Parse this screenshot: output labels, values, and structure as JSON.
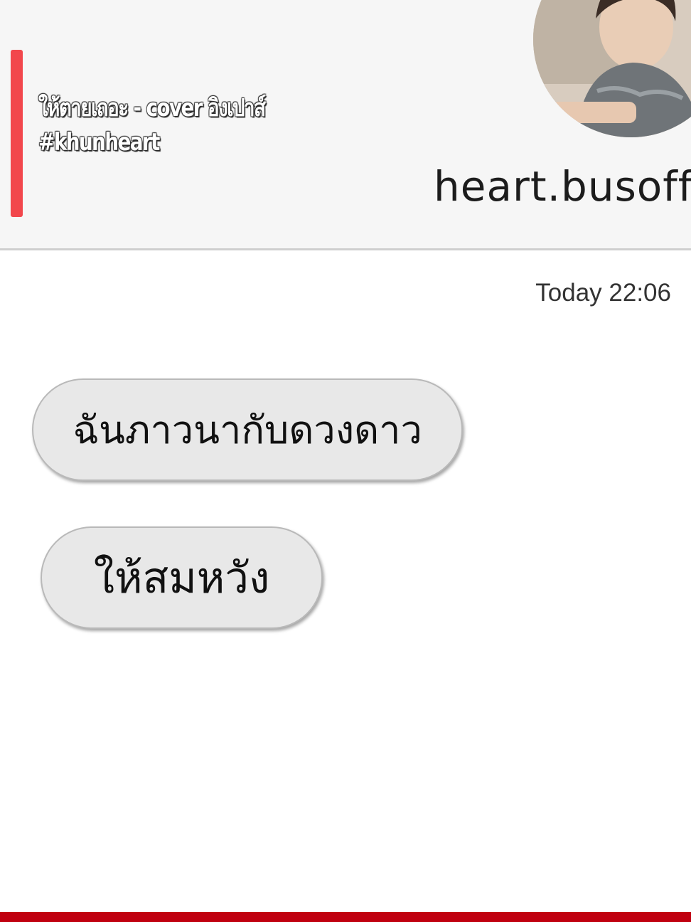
{
  "header": {
    "caption_line1": "ให้ตายเถอะ - cover อิงเปาส์",
    "caption_line2": "#khunheart",
    "username": "heart.busoff",
    "avatar_description": "profile-photo"
  },
  "chat": {
    "timestamp": "Today 22:06",
    "messages": [
      {
        "text": "ฉันภาวนากับดวงดาว"
      },
      {
        "text": "ให้สมหวัง"
      }
    ]
  },
  "colors": {
    "accent": "#f2474c",
    "bottom_bar": "#c0000f",
    "bubble_bg": "#e8e8e8",
    "header_bg": "#f6f6f6"
  }
}
